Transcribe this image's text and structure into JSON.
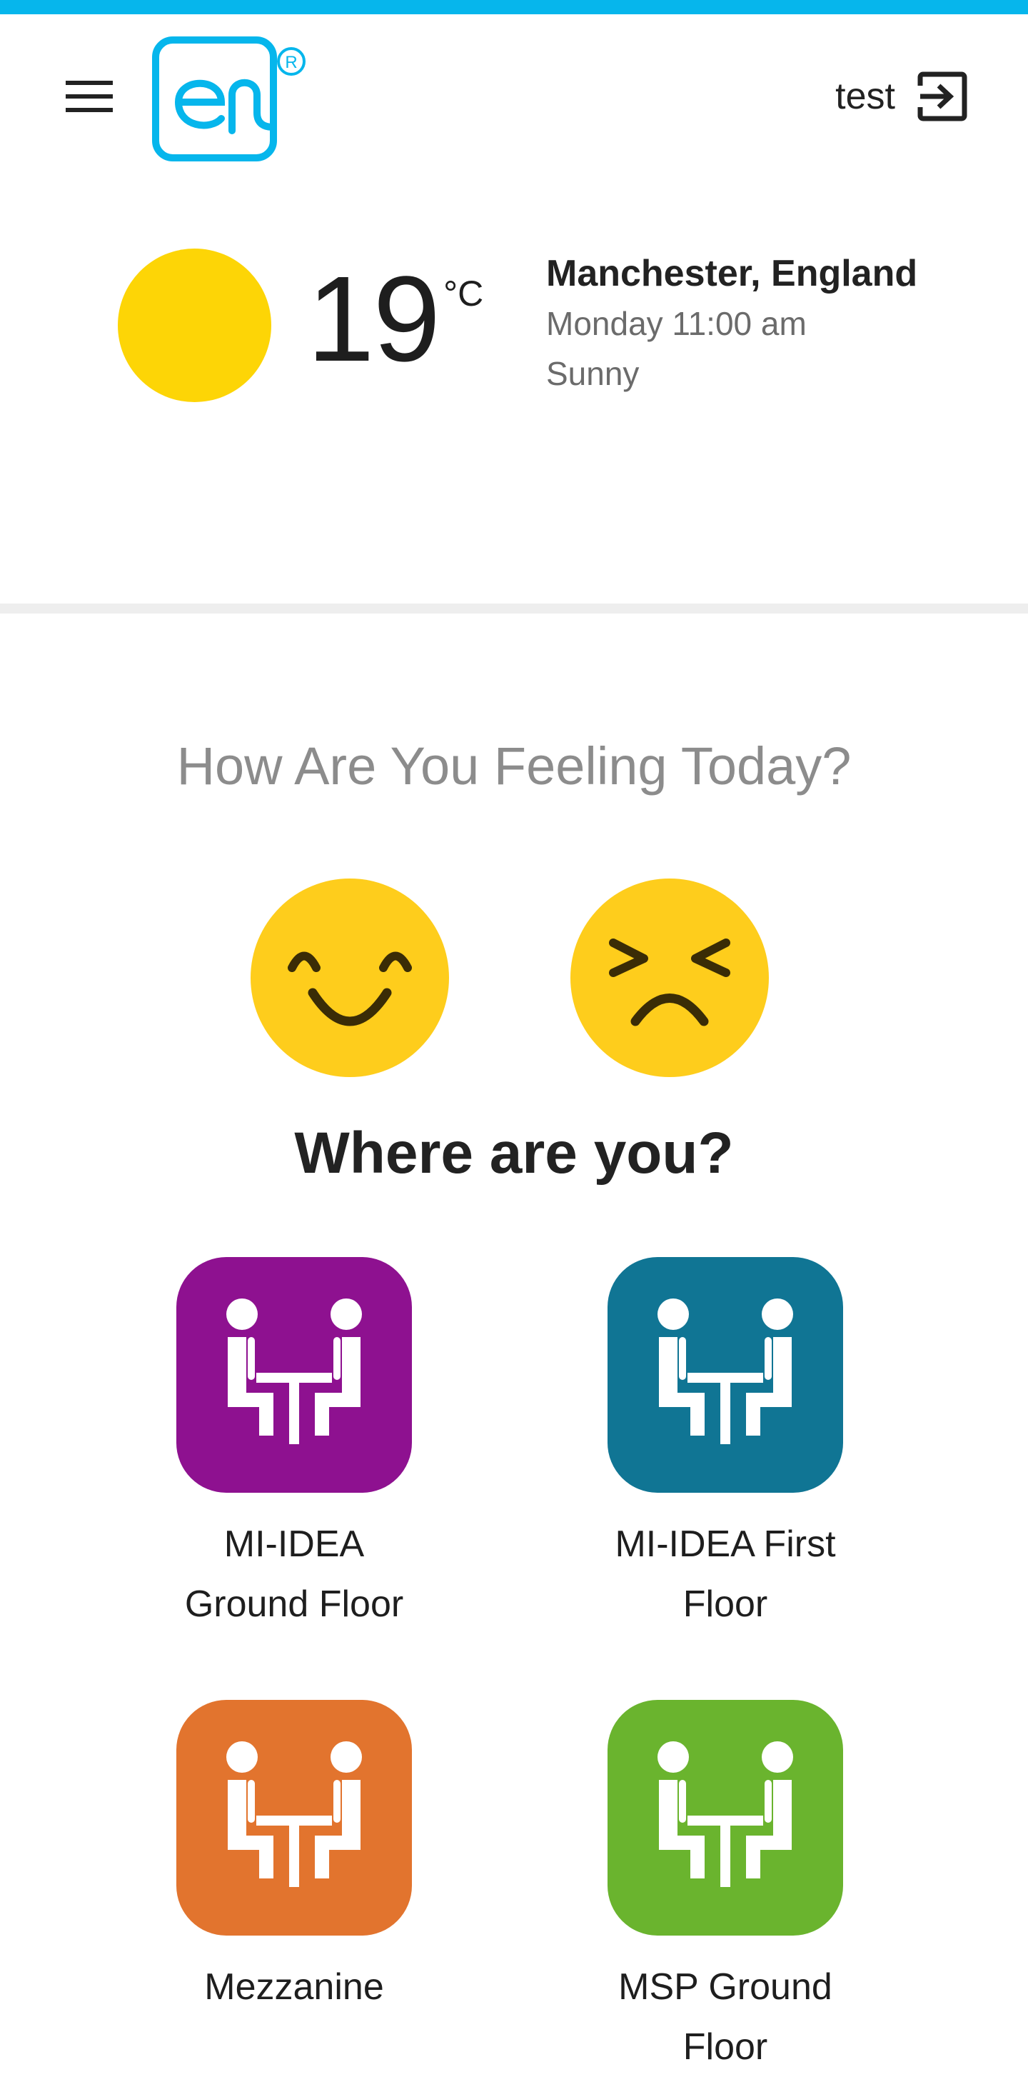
{
  "header": {
    "user_name": "test",
    "menu_icon": "hamburger-menu-icon",
    "logout_icon": "logout-icon",
    "brand_color": "#06b6ec"
  },
  "weather": {
    "temperature": "19",
    "unit": "°C",
    "location": "Manchester, England",
    "datetime": "Monday 11:00 am",
    "condition": "Sunny",
    "icon": "sun-icon"
  },
  "feeling": {
    "title": "How Are You Feeling Today?",
    "options": [
      {
        "name": "happy",
        "icon": "happy-face-icon"
      },
      {
        "name": "sad",
        "icon": "sad-face-icon"
      }
    ]
  },
  "locations": {
    "title": "Where are you?",
    "items": [
      {
        "label": "MI-IDEA Ground Floor",
        "color": "#8e1190",
        "icon": "meeting-table-icon"
      },
      {
        "label": "MI-IDEA First Floor",
        "color": "#107594",
        "icon": "meeting-table-icon"
      },
      {
        "label": "Mezzanine",
        "color": "#e2742e",
        "icon": "meeting-table-icon"
      },
      {
        "label": "MSP Ground Floor",
        "color": "#6ab42e",
        "icon": "meeting-table-icon"
      }
    ]
  }
}
